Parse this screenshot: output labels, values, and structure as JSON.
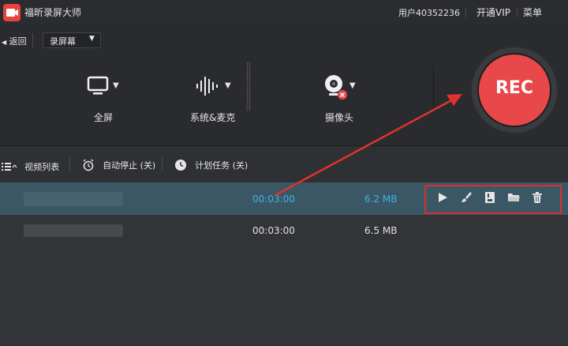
{
  "titlebar": {
    "app_title": "福昕录屏大师",
    "user": "用户40352236",
    "vip": "开通VIP",
    "menu": "菜单"
  },
  "toolbar": {
    "back": "返回",
    "mode": "录屏幕"
  },
  "sources": [
    {
      "label": "全屏",
      "icon": "monitor-icon"
    },
    {
      "label": "系统&麦克",
      "icon": "audio-wave-icon"
    },
    {
      "label": "摄像头",
      "icon": "webcam-icon"
    }
  ],
  "rec_button": {
    "label": "REC"
  },
  "list_toolbar": {
    "video_list": "视频列表",
    "auto_stop": "自动停止 (关)",
    "schedule": "计划任务 (关)"
  },
  "recordings": [
    {
      "duration": "00:03:00",
      "size": "6.2 MB",
      "selected": true
    },
    {
      "duration": "00:03:00",
      "size": "6.5 MB",
      "selected": false
    }
  ],
  "row_actions": [
    "play-icon",
    "edit-brush-icon",
    "save-icon",
    "open-folder-icon",
    "trash-icon"
  ],
  "colors": {
    "accent_red": "#e8484a",
    "selected_row": "#3b5664",
    "highlight_text": "#3fb6e6",
    "annotation_red": "#d7322a"
  }
}
